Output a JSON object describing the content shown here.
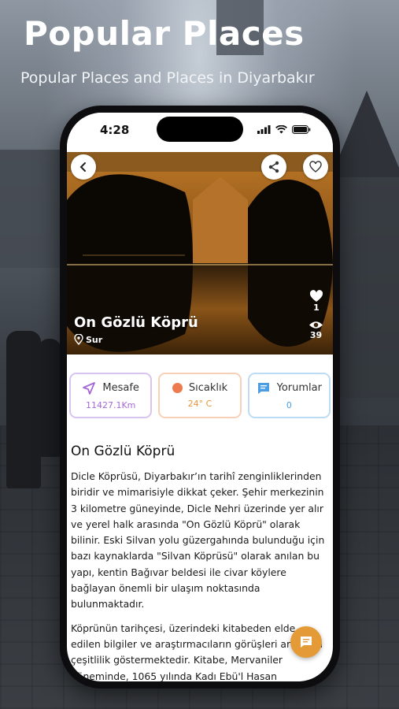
{
  "promo": {
    "title": "Popular Places",
    "subtitle": "Popular Places and Places in Diyarbakır"
  },
  "status_bar": {
    "time": "4:28"
  },
  "hero": {
    "place_name": "On Gözlü Köprü",
    "location": "Sur",
    "likes": "1",
    "views": "39"
  },
  "cards": [
    {
      "label": "Mesafe",
      "value": "11427.1Km",
      "icon": "navigation-arrow-icon",
      "color": "#a569d6"
    },
    {
      "label": "Sıcaklık",
      "value": "24° C",
      "icon": "temperature-dot-icon",
      "color": "#ee7a4f"
    },
    {
      "label": "Yorumlar",
      "value": "0",
      "icon": "comment-icon",
      "color": "#4b9ee3"
    }
  ],
  "article": {
    "heading": "On Gözlü Köprü",
    "paragraph_1": "Dicle Köprüsü, Diyarbakır’ın tarihî zenginliklerinden biridir ve mimarisiyle dikkat çeker. Şehir merkezinin 3 kilometre güneyinde, Dicle Nehri üzerinde yer alır ve yerel halk arasında \"On Gözlü Köprü\" olarak bilinir. Eski Silvan yolu güzergahında bulunduğu için bazı kaynaklarda \"Silvan Köprüsü\" olarak anılan bu yapı, kentin Bağıvar beldesi ile civar köylere bağlayan önemli bir ulaşım noktasında bulunmaktadır.",
    "paragraph_2": "Köprünün tarihçesi, üzerindeki kitabeden elde edilen bilgiler ve araştırmacıların görüşleri arasında çeşitlilik göstermektedir. Kitabe, Mervaniler döneminde, 1065 yılında Kadı Ebü'l Hasan Abdülvâhid tarafından"
  }
}
